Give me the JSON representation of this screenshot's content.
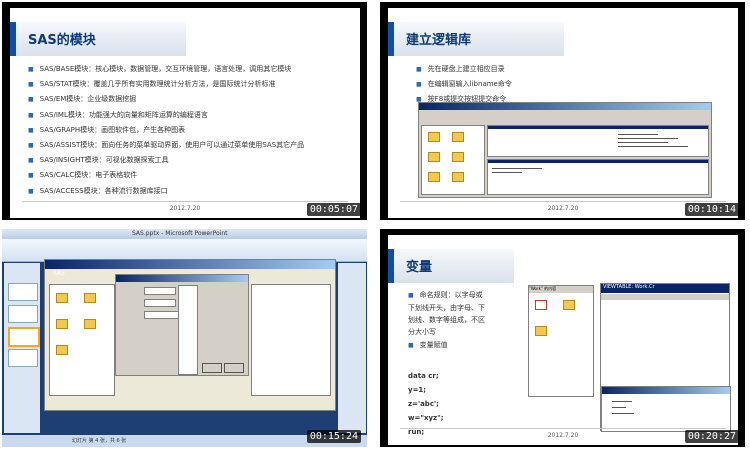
{
  "panels": [
    {
      "title": "SAS的模块",
      "bullets": [
        "SAS/BASE模块：核心模块，数据管理，交互环境管理，语言处理，调用其它模块",
        "SAS/STAT模块：覆盖几乎所有实用数理统计分析方法，是国际统计分析标准",
        "SAS/EM模块：企业级数据挖掘",
        "SAS/IML模块：功能强大的向量和矩阵运算的编程语言",
        "SAS/GRAPH模块：画图软件包，产生各种图表",
        "SAS/ASSIST模块：面向任务的菜单驱动界面，使用户可以通过菜单使用SAS其它产品",
        "SAS/INSIGHT模块：可视化数据探索工具",
        "SAS/CALC模块：电子表格软件",
        "SAS/ACCESS模块：各种流行数据库接口"
      ],
      "footer": "2012.7.20",
      "timestamp": "00:05:07"
    },
    {
      "title": "建立逻辑库",
      "bullets": [
        "先在硬盘上建立相应目录",
        "在编辑窗输入libname命令",
        "按F8或提交按钮提交命令"
      ],
      "footer": "2012.7.20",
      "timestamp": "00:10:14"
    },
    {
      "window_title": "SAS.pptx - Microsoft PowerPoint",
      "app_title": "SAS",
      "status_text": "幻灯片 第 4 张，共 6 张",
      "timestamp": "00:15:24"
    },
    {
      "title": "变量",
      "bullets": [
        "命名规则：以字母或下划线开头，由字母、下划线、数字等组成，不区分大小写",
        "变量赋值"
      ],
      "code": [
        "data cr;",
        "y=1;",
        "z='abc';",
        "w=\"xyz\";",
        "run;"
      ],
      "explorer_title": "\"Work\" 的内容",
      "viewtable_title": "VIEWTABLE: Work.Cr",
      "footer": "2012.7.20",
      "timestamp": "00:20:27"
    }
  ]
}
